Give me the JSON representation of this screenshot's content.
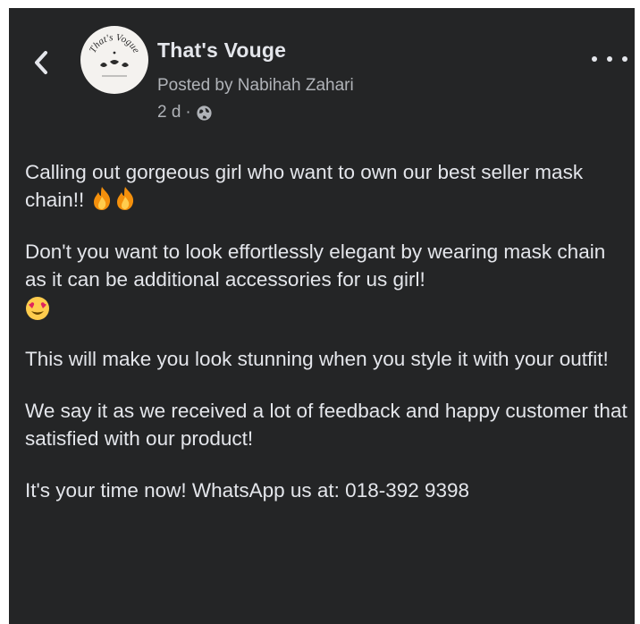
{
  "post": {
    "page_name": "That's Vouge",
    "posted_by": "Posted by Nabihah Zahari",
    "time": "2 d",
    "separator": "·",
    "avatar_text": "That's Vogue",
    "paragraphs": {
      "p1": "Calling out gorgeous girl who want to own our best seller mask chain!!",
      "p2": "Don't you want to look effortlessly elegant by wearing mask chain as it can be additional accessories for us girl!",
      "p3": "This will make you look stunning when you style it with your outfit!",
      "p4": "We say it as we received a lot of feedback and happy customer that satisfied with our product!",
      "p5": "It's your time now! WhatsApp us at: 018-392 9398"
    }
  },
  "icons": {
    "back": "chevron-left-icon",
    "more": "more-horizontal-icon",
    "audience": "globe-icon",
    "fire": "fire-emoji",
    "heart_eyes": "heart-eyes-emoji"
  },
  "colors": {
    "background": "#242526",
    "primary_text": "#e4e6eb",
    "secondary_text": "#b0b3b8"
  }
}
